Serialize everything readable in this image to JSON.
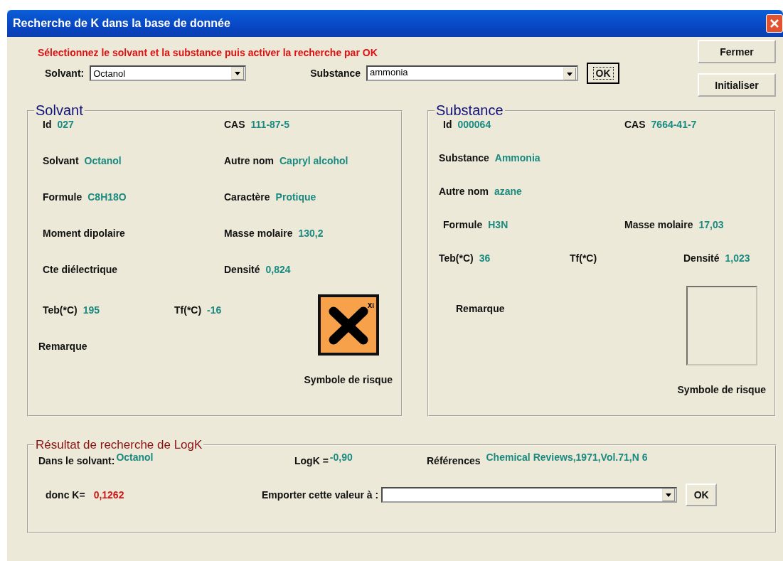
{
  "window": {
    "title": "Recherche de K dans la base de donnée"
  },
  "instruction": "Sélectionnez le solvant et la substance puis activer la recherche par OK",
  "solvent_select": {
    "label": "Solvant:",
    "value": "Octanol"
  },
  "substance_select": {
    "label": "Substance",
    "value": "ammonia"
  },
  "search_button": "OK",
  "side_buttons": [
    "Fermer",
    "Initialiser"
  ],
  "solvent_panel": {
    "title": "Solvant",
    "rows": [
      [
        {
          "label": "Id",
          "value": "027"
        },
        {
          "label": "CAS",
          "value": "111-87-5"
        }
      ],
      [
        {
          "label": "Solvant",
          "value": "Octanol"
        },
        {
          "label": "Autre nom",
          "value": "Capryl alcohol"
        }
      ],
      [
        {
          "label": "Formule",
          "value": "C8H18O"
        },
        {
          "label": "Caractère",
          "value": "Protique"
        }
      ],
      [
        {
          "label": "Moment dipolaire"
        },
        {
          "label": "Masse molaire",
          "value": "130,2"
        }
      ],
      [
        {
          "label": "Cte diélectrique"
        },
        {
          "label": "Densité",
          "value": "0,824"
        }
      ]
    ],
    "rows_beside_symbol": [
      [
        {
          "label": "Teb(*C)",
          "value": "195"
        },
        {
          "label": "Tf(*C)",
          "value": "-16"
        }
      ],
      [
        {
          "label": "Remarque"
        }
      ]
    ],
    "symbol": {
      "kind": "irritant",
      "code": "Xi"
    },
    "symbol_caption": "Symbole de risque"
  },
  "substance_panel": {
    "title": "Substance",
    "rows": [
      [
        {
          "label": "Id",
          "value": "000064"
        },
        {
          "label": "CAS",
          "value": "7664-41-7"
        }
      ],
      [
        {
          "label": "Substance",
          "value": "Ammonia"
        }
      ],
      [
        {
          "label": "Autre nom",
          "value": "azane"
        }
      ],
      [
        {
          "label": "Formule",
          "value": "H3N"
        },
        {
          "label": "Masse molaire",
          "value": "17,03"
        }
      ],
      [
        {
          "label": "Teb(*C)",
          "value": "36"
        },
        {
          "label": "Tf(*C)"
        },
        {
          "label": "Densité",
          "value": "1,023"
        }
      ]
    ],
    "rows_beside_symbol": [
      [
        {
          "label": "Remarque"
        }
      ]
    ],
    "symbol": {
      "kind": "empty"
    },
    "symbol_caption": "Symbole de risque"
  },
  "result_panel": {
    "title": "Résultat de recherche de LogK",
    "solvent_label": "Dans le solvant:",
    "solvent_value": "Octanol",
    "logk_label": "LogK =",
    "logk_value": "-0,90",
    "references_label": "Références",
    "references_value": "Chemical Reviews,1971,Vol.71,N 6",
    "k_label": "donc K=",
    "k_value": "0,1262",
    "export_label": "Emporter cette valeur à :",
    "export_button": "OK"
  }
}
